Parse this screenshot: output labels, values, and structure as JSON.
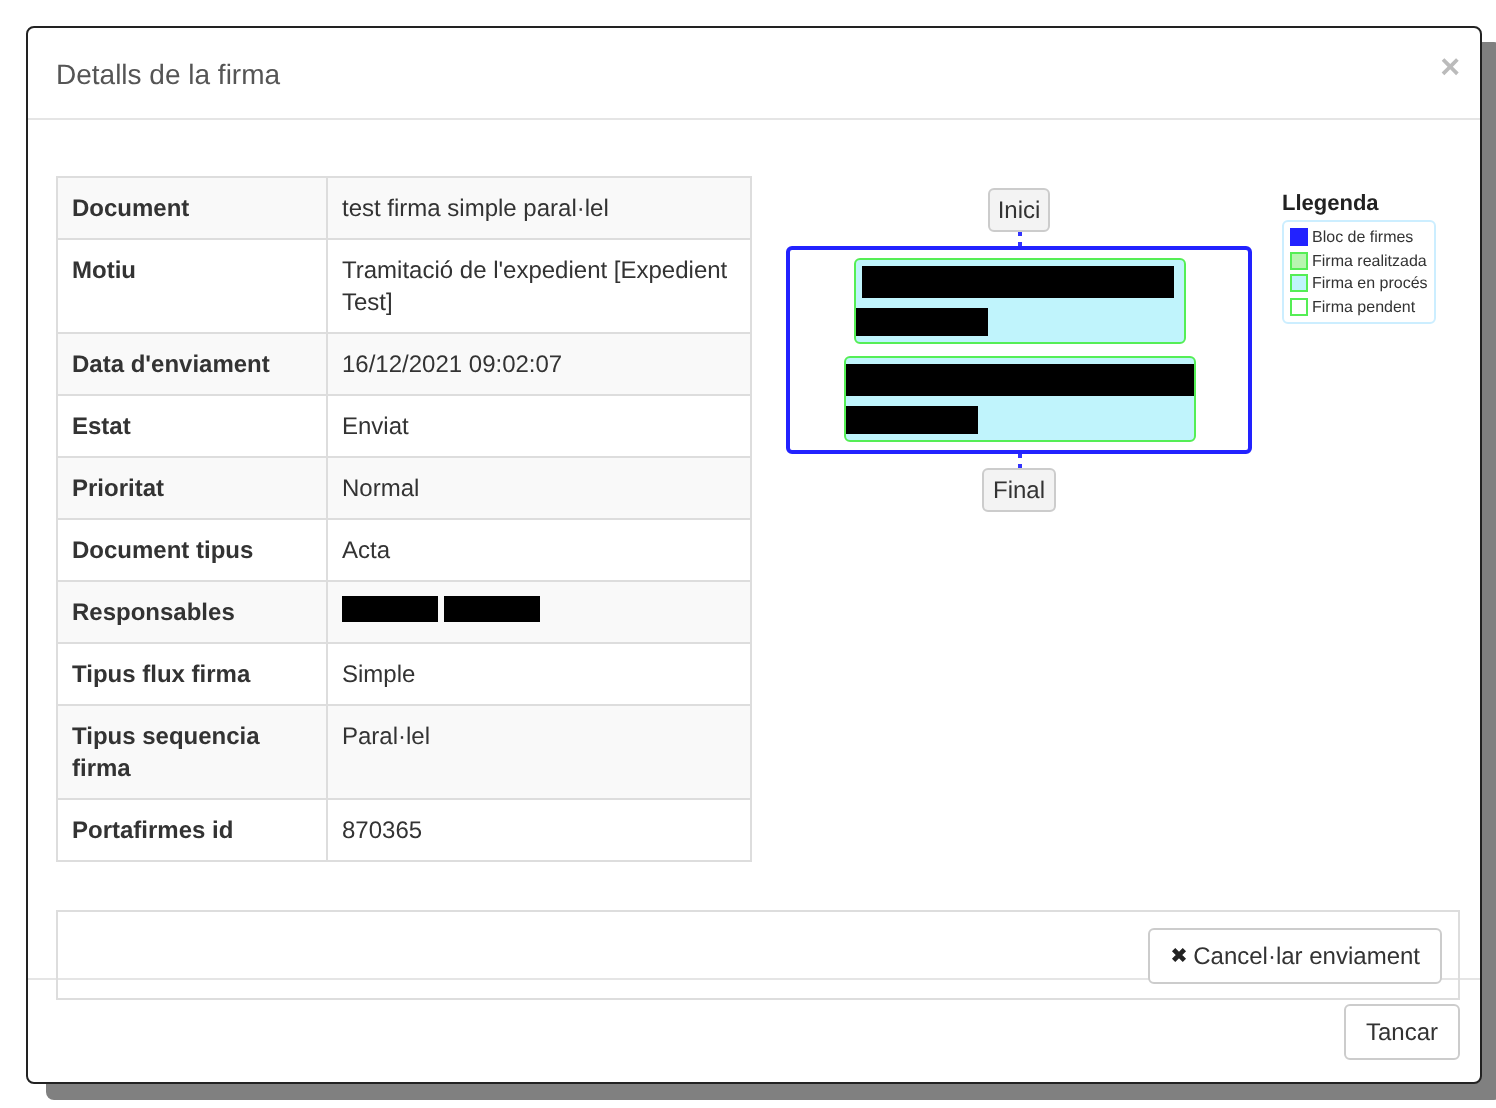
{
  "dialog": {
    "title": "Detalls de la firma",
    "close": "×"
  },
  "details": [
    {
      "label": "Document",
      "value": "test firma simple paral·lel"
    },
    {
      "label": "Motiu",
      "value": "Tramitació de l'expedient [Expedient Test]"
    },
    {
      "label": "Data d'enviament",
      "value": "16/12/2021 09:02:07"
    },
    {
      "label": "Estat",
      "value": "Enviat"
    },
    {
      "label": "Prioritat",
      "value": "Normal"
    },
    {
      "label": "Document tipus",
      "value": "Acta"
    },
    {
      "label": "Responsables",
      "kind": "redacted"
    },
    {
      "label": "Tipus flux firma",
      "value": "Simple"
    },
    {
      "label": "Tipus sequencia firma",
      "value": "Paral·lel"
    },
    {
      "label": "Portafirmes id",
      "value": "870365"
    }
  ],
  "flow": {
    "start": "Inici",
    "end": "Final",
    "signers": [
      {
        "color": "#c0f4fc",
        "kind": "redacted"
      },
      {
        "color": "#c0f4fc",
        "kind": "redacted"
      }
    ]
  },
  "legend": {
    "title": "Llegenda",
    "items": [
      {
        "label": "Bloc de firmes",
        "color": "#2222ff"
      },
      {
        "label": "Firma realitzada",
        "color": "#b8f5b0"
      },
      {
        "label": "Firma en procés",
        "color": "#c0f4fc"
      },
      {
        "label": "Firma pendent",
        "color": "#ffffff"
      }
    ]
  },
  "actions": {
    "cancel": "Cancel·lar enviament"
  },
  "buttons": [
    "Tancar"
  ]
}
